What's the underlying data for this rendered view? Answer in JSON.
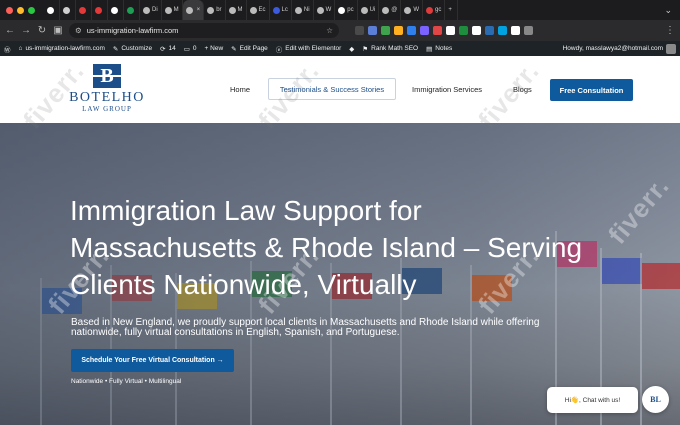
{
  "browser": {
    "traffic_colors": [
      "#ff5f57",
      "#febc2e",
      "#28c840"
    ],
    "tabs": [
      {
        "label": "",
        "fav": "#ffffff"
      },
      {
        "label": "",
        "fav": "#cfcfcf"
      },
      {
        "label": "",
        "fav": "#e03a3a"
      },
      {
        "label": "",
        "fav": "#e03a3a"
      },
      {
        "label": "",
        "fav": "#ffffff"
      },
      {
        "label": "",
        "fav": "#1f9d55"
      },
      {
        "label": "Di",
        "fav": "#bbbbbb"
      },
      {
        "label": "M",
        "fav": "#bbbbbb"
      },
      {
        "label": "",
        "fav": "#bbbbbb",
        "active": true
      },
      {
        "label": "br",
        "fav": "#bbbbbb"
      },
      {
        "label": "M",
        "fav": "#bbbbbb"
      },
      {
        "label": "Ec",
        "fav": "#bbbbbb"
      },
      {
        "label": "Lc",
        "fav": "#3b5bdb"
      },
      {
        "label": "Ni",
        "fav": "#bbbbbb"
      },
      {
        "label": "W",
        "fav": "#bbbbbb"
      },
      {
        "label": "pc",
        "fav": "#ffffff"
      },
      {
        "label": "Ui",
        "fav": "#bbbbbb"
      },
      {
        "label": "@",
        "fav": "#bbbbbb"
      },
      {
        "label": "W",
        "fav": "#bbbbbb"
      },
      {
        "label": "gc",
        "fav": "#e03a3a"
      }
    ],
    "new_tab": "+",
    "url": "us-immigration-lawfirm.com",
    "extension_colors": [
      "#4a4a4a",
      "#5b7fd6",
      "#3fa34d",
      "#ffb020",
      "#2f80ed",
      "#7b61ff",
      "#e04646",
      "#ffffff",
      "#1e8e3e",
      "#ffffff",
      "#2b6cb0",
      "#00a3e0",
      "#ffffff",
      "#888888"
    ]
  },
  "wp_admin": {
    "site": "us-immigration-lawfirm.com",
    "customize": "Customize",
    "updates": "14",
    "comments": "0",
    "new": "+ New",
    "edit_page": "Edit Page",
    "elementor": "Edit with Elementor",
    "rankmath": "Rank Math SEO",
    "notes": "Notes",
    "howdy": "Howdy, masslawya2@hotmail.com"
  },
  "header": {
    "logo_mark": "B",
    "logo_name": "BOTELHO",
    "logo_sub": "LAW GROUP",
    "menu": {
      "home": "Home",
      "testimonials": "Testimonials & Success Stories",
      "immigration": "Immigration Services",
      "blogs": "Blogs"
    },
    "cta": "Free Consultation"
  },
  "hero": {
    "title": "Immigration Law Support for Massachusetts & Rhode Island – Serving Clients Nationwide, Virtually",
    "text": "Based in New England, we proudly support local clients in Massachusetts and Rhode Island while offering nationwide, fully virtual consultations in English, Spanish, and Portuguese.",
    "button": "Schedule Your Free Virtual Consultation →",
    "tags": "Nationwide • Fully Virtual • Multilingual"
  },
  "chat": {
    "bubble": "Hi👋, Chat with us!",
    "avatar": "BL"
  },
  "watermark": "fiverr."
}
